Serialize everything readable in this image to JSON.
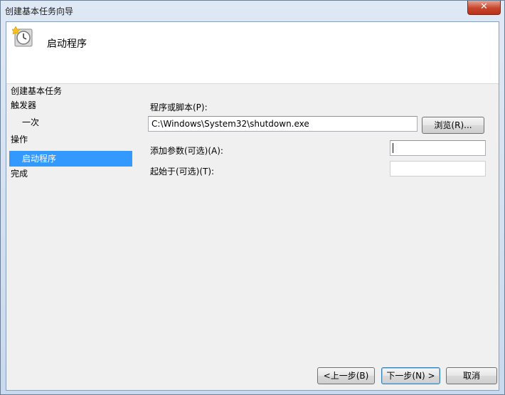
{
  "window": {
    "title": "创建基本任务向导",
    "close_glyph": "✕"
  },
  "header": {
    "title": "启动程序",
    "icon": "clock-star-icon"
  },
  "nav": {
    "title": "创建基本任务",
    "items": [
      {
        "label": "触发器"
      },
      {
        "label": "一次"
      },
      {
        "label": "操作"
      },
      {
        "label": "启动程序"
      },
      {
        "label": "完成"
      }
    ],
    "selected": "启动程序"
  },
  "form": {
    "program_label": "程序或脚本(P):",
    "program_value": "C:\\Windows\\System32\\shutdown.exe",
    "browse_label": "浏览(R)...",
    "args_label": "添加参数(可选)(A):",
    "args_value": "",
    "startin_label": "起始于(可选)(T):",
    "startin_value": ""
  },
  "footer": {
    "back_label": "<上一步(B)",
    "next_label": "下一步(N) >",
    "cancel_label": "取消"
  },
  "colors": {
    "selection": "#3399ff",
    "close_button": "#c7452c"
  }
}
